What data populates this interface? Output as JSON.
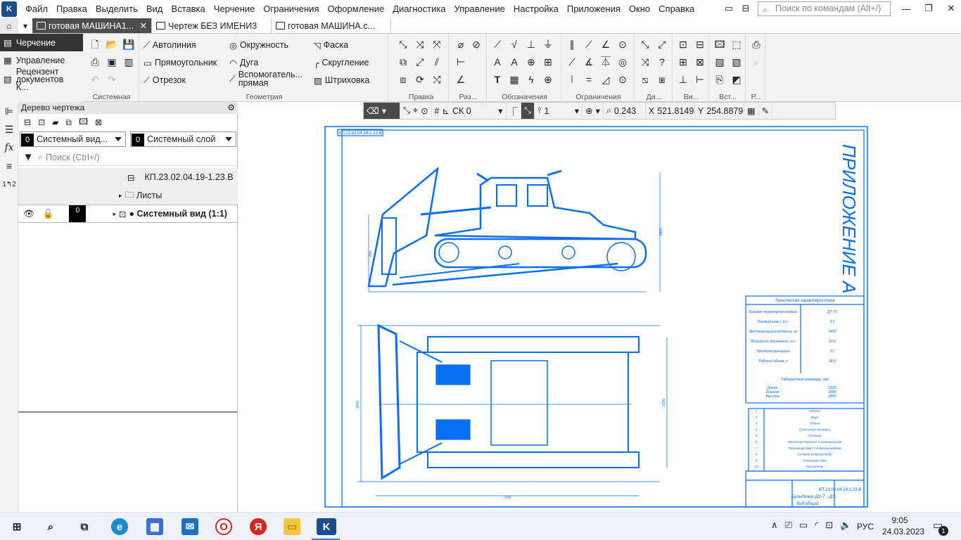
{
  "menubar": {
    "items": [
      "Файл",
      "Правка",
      "Выделить",
      "Вид",
      "Вставка",
      "Черчение",
      "Ограничения",
      "Оформление",
      "Диагностика",
      "Управление",
      "Настройка",
      "Приложения",
      "Окно",
      "Справка"
    ],
    "search_placeholder": "Поиск по командам (Alt+/)"
  },
  "tabs": [
    {
      "label": "готовая МАШИНА1..."
    },
    {
      "label": "Чертеж БЕЗ ИМЕНИ3"
    },
    {
      "label": "готовая МАШИНА.c..."
    }
  ],
  "ribbon": {
    "left": {
      "items": [
        "Черчение",
        "Управление",
        "Рецензент документов К..."
      ]
    },
    "group_system": "Системная",
    "group_geometry": "Геометрия",
    "geometry": {
      "autoline": "Автолиния",
      "rectangle": "Прямоугольник",
      "segment": "Отрезок",
      "circle": "Окружность",
      "arc": "Дуга",
      "aux_line": "Вспомогатель... прямая",
      "chamfer": "Фаска",
      "fillet": "Скругление",
      "hatch": "Штриховка"
    },
    "group_edit": "Правка",
    "group_raz": "Раз...",
    "group_designations": "Обозначения",
    "group_constraints": "Ограничения",
    "group_di": "Ди...",
    "group_vi": "Ви...",
    "group_vst": "Вст...",
    "group_r": "Р..."
  },
  "panel": {
    "title": "Дерево чертежа",
    "view_combo": {
      "num": "0",
      "label": "Системный вид..."
    },
    "layer_combo": {
      "num": "0",
      "label": "Системный слой"
    },
    "search_placeholder": "Поиск (Ctrl+/)",
    "tree": {
      "doc": "КП.23.02.04.19-1.23.В",
      "sheets": "Листы",
      "view": "● Системный вид (1:1)",
      "view_num": "0"
    }
  },
  "dtool": {
    "cs": "СК 0",
    "layer": "1",
    "zoom": "0.243",
    "x_label": "X",
    "x_val": "521.8149",
    "y_label": "Y",
    "y_val": "254.8879"
  },
  "drawing": {
    "title": "ПРИЛОЖЕНИЕ А",
    "stamp_top": "КП.23.02.04.19-1.23.В",
    "table_header": "Техническая характеристика",
    "specs": [
      [
        "Базовая тракторная модель",
        "ДТ-75"
      ],
      [
        "Тяговый класс, т.с.",
        "3,0"
      ],
      [
        "Эксплуатационная масса, кг",
        "9400"
      ],
      [
        "Мощность двигателя, л.с.",
        "90,0"
      ],
      [
        "Частота вращения",
        "57"
      ],
      [
        "Рабочий объем, л",
        "58,9"
      ]
    ],
    "dims_title": "Габаритные размеры, мм",
    "dims": [
      [
        "Длина",
        "5320"
      ],
      [
        "Ширина",
        "3440"
      ],
      [
        "Высота",
        "2850"
      ]
    ],
    "parts": [
      [
        "1",
        "Кабина"
      ],
      [
        "2",
        "Фара"
      ],
      [
        "3",
        "Отвал"
      ],
      [
        "4",
        "Гусеничная тележка"
      ],
      [
        "5",
        "Гусеница"
      ],
      [
        "6",
        "Механизм перекоса и гидроцилиндр"
      ],
      [
        "7",
        "Толкающий брус с гидроцилиндром"
      ],
      [
        "8",
        "Силовой гидроцилиндр"
      ],
      [
        "9",
        "Толкающий брус"
      ],
      [
        "10",
        "Рыхлитель"
      ]
    ],
    "title_block": "Бульдозер ДЗ-7 - ДЭ",
    "view_label": "Вид общий",
    "dim_side_h": "2850",
    "dim_side_l": "850",
    "dim_top_w": "3440",
    "dim_top_l": "7330",
    "dim_top_in": "2250"
  },
  "taskbar": {
    "lang": "РУС",
    "time": "9:05",
    "date": "24.03.2023",
    "notif": "1"
  }
}
